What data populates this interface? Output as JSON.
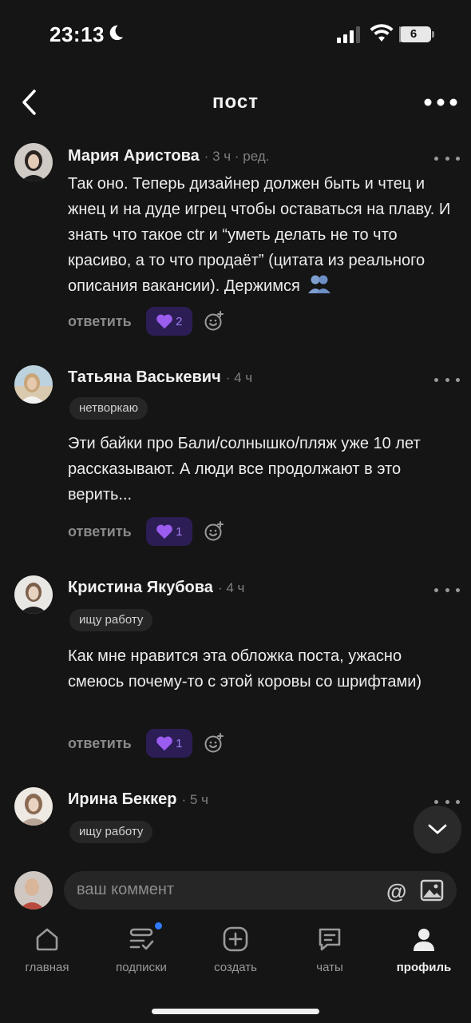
{
  "status_bar": {
    "time": "23:13",
    "battery": "6",
    "battery_level": 0.06
  },
  "header": {
    "title": "пост"
  },
  "comments": [
    {
      "author": "Мария Аристова",
      "meta": "· 3 ч · ред.",
      "tag": "",
      "text": "Так оно. Теперь дизайнер должен быть и чтец и жнец и на дуде игрец чтобы оставаться на плаву. И знать что такое ctr и “уметь делать не то что красиво, а то что продаёт” (цитата из реального описания вакансии). Держимся",
      "reply_label": "ответить",
      "reaction_count": "2"
    },
    {
      "author": "Татьяна Васькевич",
      "meta": "· 4 ч",
      "tag": "нетворкаю",
      "text": "Эти байки про Бали/солнышко/пляж уже 10 лет рассказывают. А люди все продолжают в это верить...",
      "reply_label": "ответить",
      "reaction_count": "1"
    },
    {
      "author": "Кристина Якубова",
      "meta": "· 4 ч",
      "tag": "ищу работу",
      "text": "Как мне нравится эта обложка поста, ужасно смеюсь почему-то с этой коровы со шрифтами)",
      "reply_label": "ответить",
      "reaction_count": "1"
    },
    {
      "author": "Ирина Беккер",
      "meta": "· 5 ч",
      "tag": "ищу работу",
      "text": "",
      "reply_label": "",
      "reaction_count": ""
    }
  ],
  "composer": {
    "placeholder": "ваш коммент",
    "at_symbol": "@"
  },
  "tabbar": {
    "items": [
      {
        "label": "главная",
        "icon": "home-icon"
      },
      {
        "label": "подписки",
        "icon": "subscriptions-icon"
      },
      {
        "label": "создать",
        "icon": "plus-circle-icon"
      },
      {
        "label": "чаты",
        "icon": "chat-icon"
      },
      {
        "label": "профиль",
        "icon": "profile-icon"
      }
    ],
    "active": "профиль"
  },
  "colors": {
    "background": "#151515",
    "reaction_bg": "#2c1d55",
    "reaction_accent": "#a07ef0",
    "notification_dot": "#2f7bff"
  }
}
